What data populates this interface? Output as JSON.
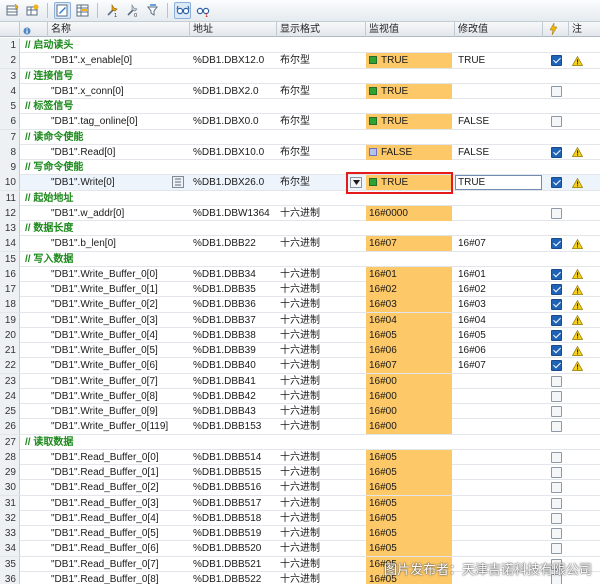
{
  "toolbar": {
    "icons": [
      "insert-row-icon",
      "insert-table-icon",
      "edit-active-icon",
      "table-edit-icon",
      "force-icon",
      "force-off-icon",
      "monitor-all-icon",
      "glasses-icon",
      "glasses-once-icon"
    ]
  },
  "headers": {
    "name": "名称",
    "address": "地址",
    "format": "显示格式",
    "monitor": "监视值",
    "modify": "修改值",
    "comment_col": "注"
  },
  "rows": [
    {
      "n": "1",
      "type": "comment",
      "text": "// 启动读头"
    },
    {
      "n": "2",
      "type": "data",
      "name": "\"DB1\".x_enable[0]",
      "addr": "%DB1.DBX12.0",
      "fmt": "布尔型",
      "mon": "TRUE",
      "led": "on",
      "mod": "TRUE",
      "check": true,
      "warn": true
    },
    {
      "n": "3",
      "type": "comment",
      "text": "// 连接信号"
    },
    {
      "n": "4",
      "type": "data",
      "name": "\"DB1\".x_conn[0]",
      "addr": "%DB1.DBX2.0",
      "fmt": "布尔型",
      "mon": "TRUE",
      "led": "on",
      "mod": "",
      "check": false,
      "warn": false
    },
    {
      "n": "5",
      "type": "comment",
      "text": "// 标签信号"
    },
    {
      "n": "6",
      "type": "data",
      "name": "\"DB1\".tag_online[0]",
      "addr": "%DB1.DBX0.0",
      "fmt": "布尔型",
      "mon": "TRUE",
      "led": "on",
      "mod": "FALSE",
      "check": false,
      "warn": false
    },
    {
      "n": "7",
      "type": "comment",
      "text": "// 读命令使能"
    },
    {
      "n": "8",
      "type": "data",
      "name": "\"DB1\".Read[0]",
      "addr": "%DB1.DBX10.0",
      "fmt": "布尔型",
      "mon": "FALSE",
      "led": "off",
      "mod": "FALSE",
      "check": true,
      "warn": true
    },
    {
      "n": "9",
      "type": "comment",
      "text": "// 写命令使能"
    },
    {
      "n": "10",
      "type": "data",
      "selected": true,
      "name": "\"DB1\".Write[0]",
      "addr": "%DB1.DBX26.0",
      "fmt": "布尔型",
      "mon": "TRUE",
      "led": "on",
      "mod": "TRUE",
      "check": true,
      "warn": true
    },
    {
      "n": "11",
      "type": "comment",
      "text": "// 起始地址"
    },
    {
      "n": "12",
      "type": "data",
      "name": "\"DB1\".w_addr[0]",
      "addr": "%DB1.DBW1364",
      "fmt": "十六进制",
      "mon": "16#0000",
      "mod": "",
      "check": false,
      "warn": false
    },
    {
      "n": "13",
      "type": "comment",
      "text": "// 数据长度"
    },
    {
      "n": "14",
      "type": "data",
      "name": "\"DB1\".b_len[0]",
      "addr": "%DB1.DBB22",
      "fmt": "十六进制",
      "mon": "16#07",
      "mod": "16#07",
      "check": true,
      "warn": true
    },
    {
      "n": "15",
      "type": "comment",
      "text": "// 写入数据"
    },
    {
      "n": "16",
      "type": "data",
      "name": "\"DB1\".Write_Buffer_0[0]",
      "addr": "%DB1.DBB34",
      "fmt": "十六进制",
      "mon": "16#01",
      "mod": "16#01",
      "check": true,
      "warn": true
    },
    {
      "n": "17",
      "type": "data",
      "name": "\"DB1\".Write_Buffer_0[1]",
      "addr": "%DB1.DBB35",
      "fmt": "十六进制",
      "mon": "16#02",
      "mod": "16#02",
      "check": true,
      "warn": true
    },
    {
      "n": "18",
      "type": "data",
      "name": "\"DB1\".Write_Buffer_0[2]",
      "addr": "%DB1.DBB36",
      "fmt": "十六进制",
      "mon": "16#03",
      "mod": "16#03",
      "check": true,
      "warn": true
    },
    {
      "n": "19",
      "type": "data",
      "name": "\"DB1\".Write_Buffer_0[3]",
      "addr": "%DB1.DBB37",
      "fmt": "十六进制",
      "mon": "16#04",
      "mod": "16#04",
      "check": true,
      "warn": true
    },
    {
      "n": "20",
      "type": "data",
      "name": "\"DB1\".Write_Buffer_0[4]",
      "addr": "%DB1.DBB38",
      "fmt": "十六进制",
      "mon": "16#05",
      "mod": "16#05",
      "check": true,
      "warn": true
    },
    {
      "n": "21",
      "type": "data",
      "name": "\"DB1\".Write_Buffer_0[5]",
      "addr": "%DB1.DBB39",
      "fmt": "十六进制",
      "mon": "16#06",
      "mod": "16#06",
      "check": true,
      "warn": true
    },
    {
      "n": "22",
      "type": "data",
      "name": "\"DB1\".Write_Buffer_0[6]",
      "addr": "%DB1.DBB40",
      "fmt": "十六进制",
      "mon": "16#07",
      "mod": "16#07",
      "check": true,
      "warn": true
    },
    {
      "n": "23",
      "type": "data",
      "name": "\"DB1\".Write_Buffer_0[7]",
      "addr": "%DB1.DBB41",
      "fmt": "十六进制",
      "mon": "16#00",
      "mod": "",
      "check": false,
      "warn": false
    },
    {
      "n": "24",
      "type": "data",
      "name": "\"DB1\".Write_Buffer_0[8]",
      "addr": "%DB1.DBB42",
      "fmt": "十六进制",
      "mon": "16#00",
      "mod": "",
      "check": false,
      "warn": false
    },
    {
      "n": "25",
      "type": "data",
      "name": "\"DB1\".Write_Buffer_0[9]",
      "addr": "%DB1.DBB43",
      "fmt": "十六进制",
      "mon": "16#00",
      "mod": "",
      "check": false,
      "warn": false
    },
    {
      "n": "26",
      "type": "data",
      "name": "\"DB1\".Write_Buffer_0[119]",
      "addr": "%DB1.DBB153",
      "fmt": "十六进制",
      "mon": "16#00",
      "mod": "",
      "check": false,
      "warn": false
    },
    {
      "n": "27",
      "type": "comment",
      "text": "// 读取数据"
    },
    {
      "n": "28",
      "type": "data",
      "name": "\"DB1\".Read_Buffer_0[0]",
      "addr": "%DB1.DBB514",
      "fmt": "十六进制",
      "mon": "16#05",
      "mod": "",
      "check": false,
      "warn": false
    },
    {
      "n": "29",
      "type": "data",
      "name": "\"DB1\".Read_Buffer_0[1]",
      "addr": "%DB1.DBB515",
      "fmt": "十六进制",
      "mon": "16#05",
      "mod": "",
      "check": false,
      "warn": false
    },
    {
      "n": "30",
      "type": "data",
      "name": "\"DB1\".Read_Buffer_0[2]",
      "addr": "%DB1.DBB516",
      "fmt": "十六进制",
      "mon": "16#05",
      "mod": "",
      "check": false,
      "warn": false
    },
    {
      "n": "31",
      "type": "data",
      "name": "\"DB1\".Read_Buffer_0[3]",
      "addr": "%DB1.DBB517",
      "fmt": "十六进制",
      "mon": "16#05",
      "mod": "",
      "check": false,
      "warn": false
    },
    {
      "n": "32",
      "type": "data",
      "name": "\"DB1\".Read_Buffer_0[4]",
      "addr": "%DB1.DBB518",
      "fmt": "十六进制",
      "mon": "16#05",
      "mod": "",
      "check": false,
      "warn": false
    },
    {
      "n": "33",
      "type": "data",
      "name": "\"DB1\".Read_Buffer_0[5]",
      "addr": "%DB1.DBB519",
      "fmt": "十六进制",
      "mon": "16#05",
      "mod": "",
      "check": false,
      "warn": false
    },
    {
      "n": "34",
      "type": "data",
      "name": "\"DB1\".Read_Buffer_0[6]",
      "addr": "%DB1.DBB520",
      "fmt": "十六进制",
      "mon": "16#05",
      "mod": "",
      "check": false,
      "warn": false
    },
    {
      "n": "35",
      "type": "data",
      "name": "\"DB1\".Read_Buffer_0[7]",
      "addr": "%DB1.DBB521",
      "fmt": "十六进制",
      "mon": "16#05",
      "mod": "",
      "check": false,
      "warn": false
    },
    {
      "n": "36",
      "type": "data",
      "name": "\"DB1\".Read_Buffer_0[8]",
      "addr": "%DB1.DBB522",
      "fmt": "十六进制",
      "mon": "16#05",
      "mod": "",
      "check": false,
      "warn": false
    }
  ],
  "watermark": "图片发布者：天津吉诺科技有限公司",
  "colors": {
    "monitor_bg": "#fdc867",
    "comment_text": "#1e8a1e",
    "highlight_box": "#e31b1b",
    "checkbox_on": "#1f63b6"
  }
}
